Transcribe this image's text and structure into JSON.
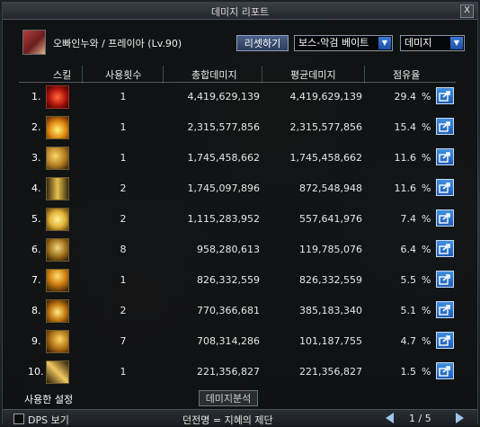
{
  "window": {
    "title": "데미지 리포트",
    "close_label": "X"
  },
  "character": {
    "name": "오빠인누와 / 프레이아 (Lv.90)"
  },
  "controls": {
    "reset_label": "리셋하기",
    "target_select": {
      "value": "보스-악검 베이트"
    },
    "type_select": {
      "value": "데미지"
    }
  },
  "columns": {
    "skill": "스킬",
    "count": "사용횟수",
    "total": "총합데미지",
    "avg": "평균데미지",
    "share": "점유율"
  },
  "rows": [
    {
      "rank": "1.",
      "count": "1",
      "total": "4,419,629,139",
      "avg": "4,419,629,139",
      "share": "29.4",
      "pct": "%",
      "icon": "skill-1-icon"
    },
    {
      "rank": "2.",
      "count": "1",
      "total": "2,315,577,856",
      "avg": "2,315,577,856",
      "share": "15.4",
      "pct": "%",
      "icon": "skill-2-icon"
    },
    {
      "rank": "3.",
      "count": "1",
      "total": "1,745,458,662",
      "avg": "1,745,458,662",
      "share": "11.6",
      "pct": "%",
      "icon": "skill-3-icon"
    },
    {
      "rank": "4.",
      "count": "2",
      "total": "1,745,097,896",
      "avg": "872,548,948",
      "share": "11.6",
      "pct": "%",
      "icon": "skill-4-icon"
    },
    {
      "rank": "5.",
      "count": "2",
      "total": "1,115,283,952",
      "avg": "557,641,976",
      "share": "7.4",
      "pct": "%",
      "icon": "skill-5-icon"
    },
    {
      "rank": "6.",
      "count": "8",
      "total": "958,280,613",
      "avg": "119,785,076",
      "share": "6.4",
      "pct": "%",
      "icon": "skill-6-icon"
    },
    {
      "rank": "7.",
      "count": "1",
      "total": "826,332,559",
      "avg": "826,332,559",
      "share": "5.5",
      "pct": "%",
      "icon": "skill-7-icon"
    },
    {
      "rank": "8.",
      "count": "2",
      "total": "770,366,681",
      "avg": "385,183,340",
      "share": "5.1",
      "pct": "%",
      "icon": "skill-8-icon"
    },
    {
      "rank": "9.",
      "count": "7",
      "total": "708,314,286",
      "avg": "101,187,755",
      "share": "4.7",
      "pct": "%",
      "icon": "skill-9-icon"
    },
    {
      "rank": "10.",
      "count": "1",
      "total": "221,356,827",
      "avg": "221,356,827",
      "share": "1.5",
      "pct": "%",
      "icon": "skill-10-icon"
    }
  ],
  "footer": {
    "tab_settings": "사용한 설정",
    "tab_detail": "데미지분석",
    "dps_label": "DPS 보기",
    "dungeon_label": "던전명 = 지혜의 제단",
    "page": "1 / 5"
  },
  "colors": {
    "accent": "#2f74cc",
    "window_bg": "#0e1012"
  }
}
